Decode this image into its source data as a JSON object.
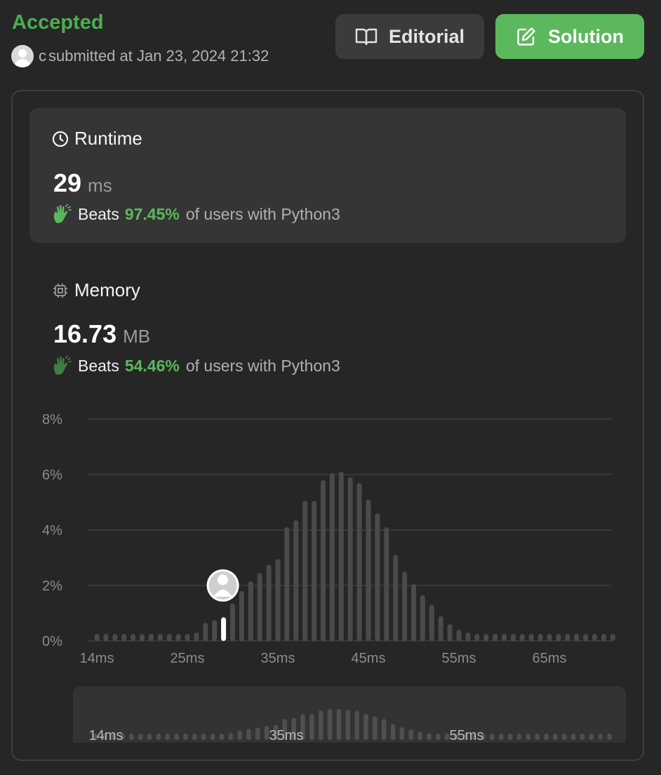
{
  "header": {
    "status": "Accepted",
    "username": "c",
    "submitted_text": "submitted at Jan 23, 2024 21:32",
    "editorial_label": "Editorial",
    "solution_label": "Solution"
  },
  "runtime": {
    "title": "Runtime",
    "value": "29",
    "unit": "ms",
    "beats_label": "Beats",
    "beats_pct": "97.45%",
    "beats_rest": "of users with Python3"
  },
  "memory": {
    "title": "Memory",
    "value": "16.73",
    "unit": "MB",
    "beats_label": "Beats",
    "beats_pct": "54.46%",
    "beats_rest": "of users with Python3"
  },
  "colors": {
    "accent": "#5cb85c",
    "bar": "#4a4a4a",
    "bar_highlight": "#ffffff",
    "grid": "#434343"
  },
  "chart_data": {
    "type": "bar",
    "ylabel": "",
    "xlabel": "",
    "y_ticks": [
      "0%",
      "2%",
      "4%",
      "6%",
      "8%"
    ],
    "ylim": [
      0,
      8
    ],
    "x_tick_labels": [
      "14ms",
      "25ms",
      "35ms",
      "45ms",
      "55ms",
      "65ms"
    ],
    "x_tick_index": [
      0,
      10,
      20,
      30,
      40,
      50
    ],
    "values": [
      0.25,
      0.25,
      0.25,
      0.25,
      0.25,
      0.25,
      0.25,
      0.25,
      0.25,
      0.25,
      0.25,
      0.3,
      0.65,
      0.75,
      0.85,
      1.35,
      1.8,
      2.15,
      2.45,
      2.75,
      2.95,
      4.1,
      4.35,
      5.05,
      5.05,
      5.8,
      6.05,
      6.1,
      5.9,
      5.7,
      5.1,
      4.6,
      4.1,
      3.1,
      2.5,
      2.05,
      1.65,
      1.3,
      0.9,
      0.6,
      0.4,
      0.3,
      0.25,
      0.25,
      0.25,
      0.25,
      0.25,
      0.25,
      0.25,
      0.25,
      0.25,
      0.25,
      0.25,
      0.25,
      0.25,
      0.25,
      0.25,
      0.25
    ],
    "highlight_index": 14,
    "grid": true,
    "navigator_labels": [
      "14ms",
      "35ms",
      "55ms"
    ],
    "navigator_label_index": [
      0,
      20,
      40
    ]
  }
}
